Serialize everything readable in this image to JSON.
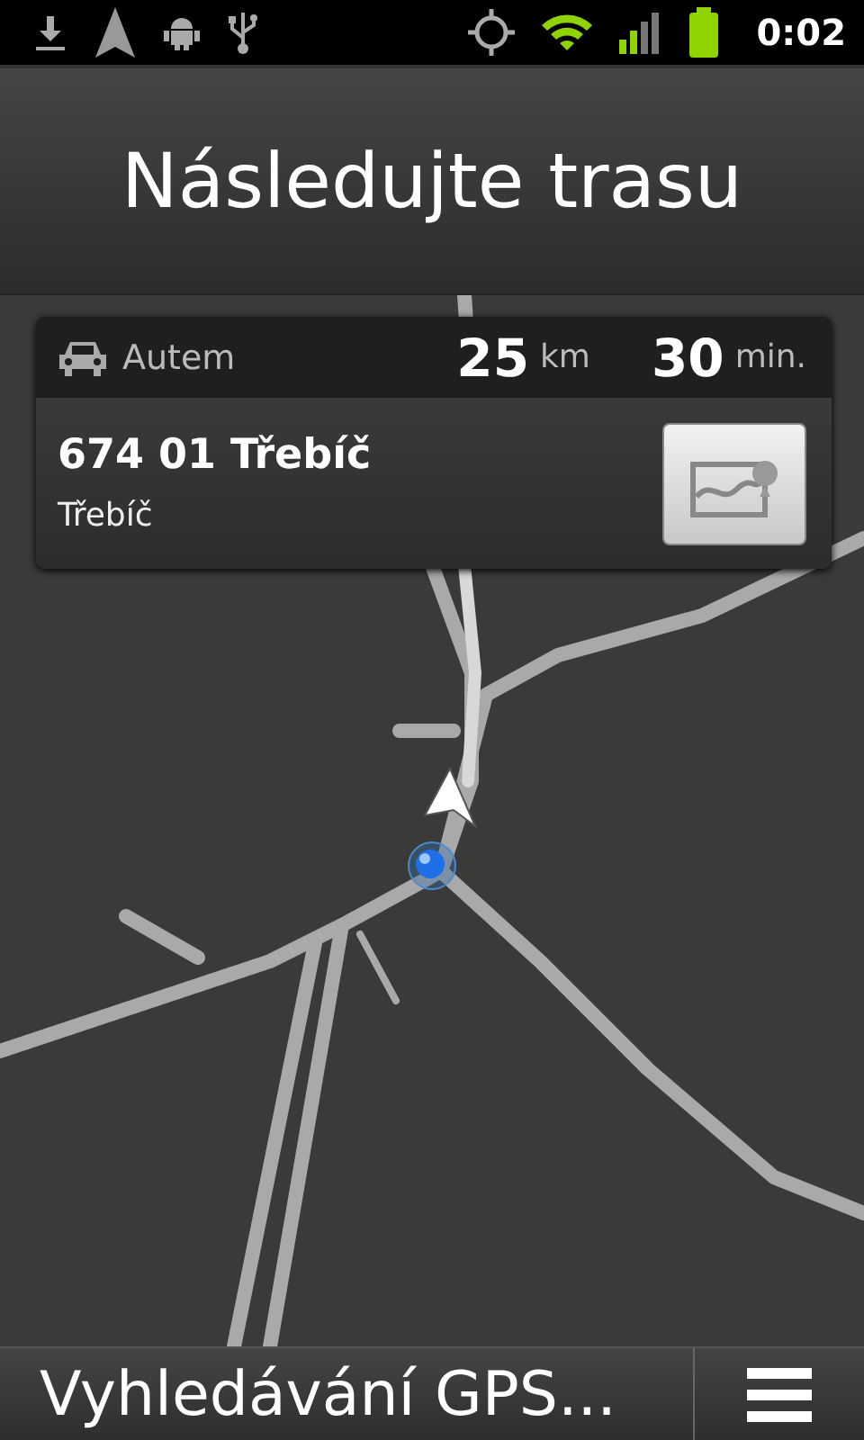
{
  "status_bar": {
    "time": "0:02"
  },
  "title": "Následujte trasu",
  "route": {
    "mode": "Autem",
    "distance": "25",
    "distance_unit": "km",
    "duration": "30",
    "duration_unit": "min."
  },
  "destination": {
    "name": "674 01 Třebíč",
    "city": "Třebíč"
  },
  "bottom_bar": {
    "label": "Vyhledávání GPS..."
  }
}
